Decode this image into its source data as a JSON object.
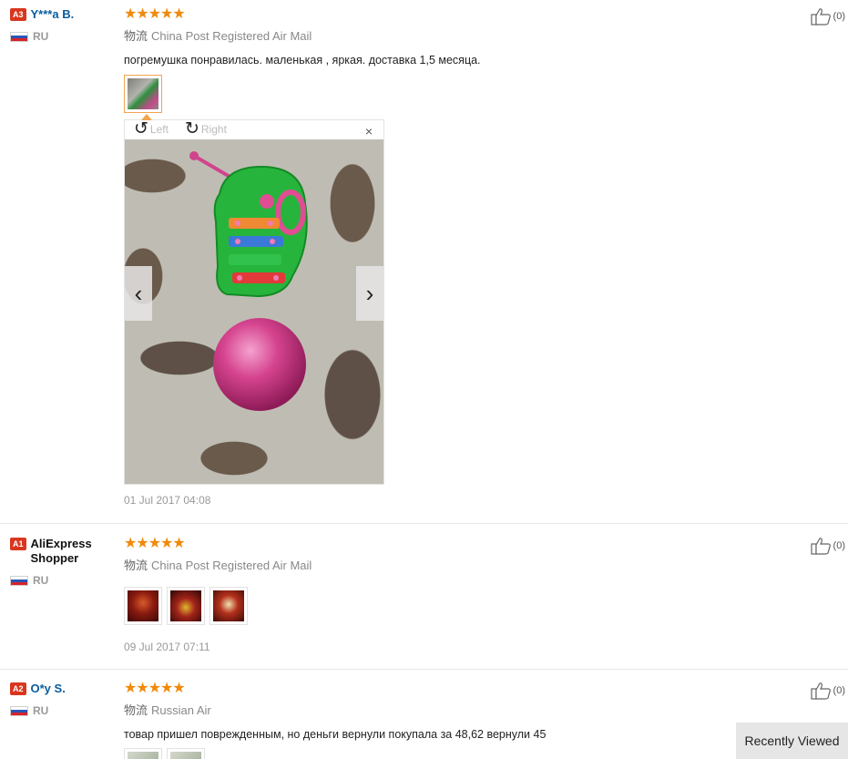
{
  "reviews": [
    {
      "level": "A3",
      "user": "Y***a B.",
      "country": "RU",
      "stars": "★★★★★",
      "logistics_label": "物流",
      "logistics": "China Post Registered Air Mail",
      "feedback": "погремушка понравилась. маленькая , яркая. доставка 1,5 месяца.",
      "date": "01 Jul 2017 04:08",
      "likes": "(0)"
    },
    {
      "level": "A1",
      "user": "AliExpress Shopper",
      "country": "RU",
      "stars": "★★★★★",
      "logistics_label": "物流",
      "logistics": "China Post Registered Air Mail",
      "date": "09 Jul 2017 07:11",
      "likes": "(0)"
    },
    {
      "level": "A2",
      "user": "O*y S.",
      "country": "RU",
      "stars": "★★★★★",
      "logistics_label": "物流",
      "logistics": "Russian Air",
      "feedback": "товар пришел поврежденным, но деньги вернули покупала за 48,62 вернули 45",
      "likes": "(0)"
    }
  ],
  "viewer": {
    "rotate_left": "Left",
    "rotate_right": "Right",
    "close": "×",
    "prev": "‹",
    "next": "›"
  },
  "recently_viewed": "Recently Viewed",
  "icons": {
    "thumb_up": "thumbs-up-icon",
    "rotate_left": "rotate-left-icon",
    "rotate_right": "rotate-right-icon",
    "flag": "russia-flag-icon"
  },
  "colors": {
    "star": "#f08a0b",
    "user_link": "#0a5c9e",
    "level_badge": "#d9361f",
    "active_thumb": "#f0a44e"
  }
}
